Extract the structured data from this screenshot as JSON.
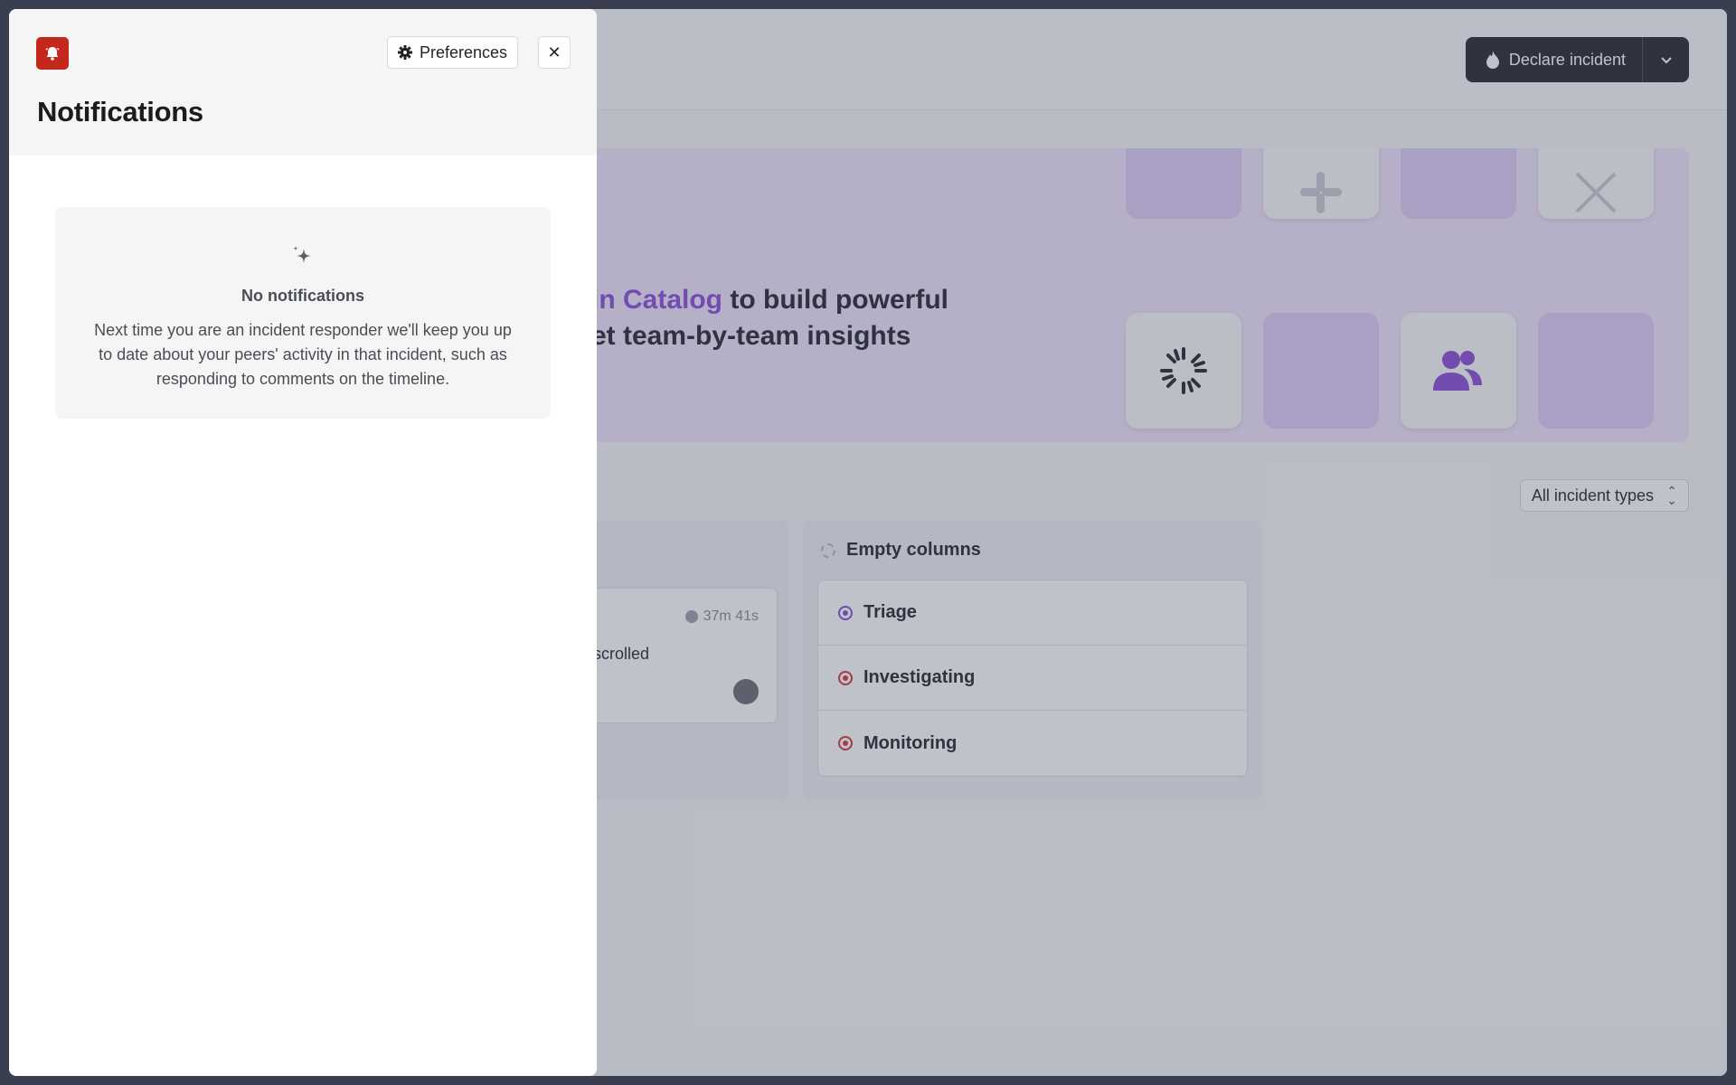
{
  "drawer": {
    "title": "Notifications",
    "preferences_label": "Preferences",
    "close_symbol": "✕",
    "brand_icon": "bell-icon",
    "brand_color": "#c4281c",
    "empty_state": {
      "icon": "sparkle-icon",
      "title": "No notifications",
      "description": "Next time you are an incident responder we'll keep you up to date about your peers' activity in that incident, such as responding to comments on the timeline."
    }
  },
  "background": {
    "declare_label": "Declare incident",
    "hero": {
      "accent_text": "in Catalog",
      "line1_rest": " to build powerful",
      "line2": "et team-by-team insights",
      "accent_color": "#8c52d8"
    },
    "filter_label": "All incident types",
    "incident_card": {
      "timer": "37m 41s",
      "text": "scrolled"
    },
    "empty_column": {
      "title": "Empty columns",
      "statuses": [
        "Triage",
        "Investigating",
        "Monitoring"
      ]
    }
  }
}
